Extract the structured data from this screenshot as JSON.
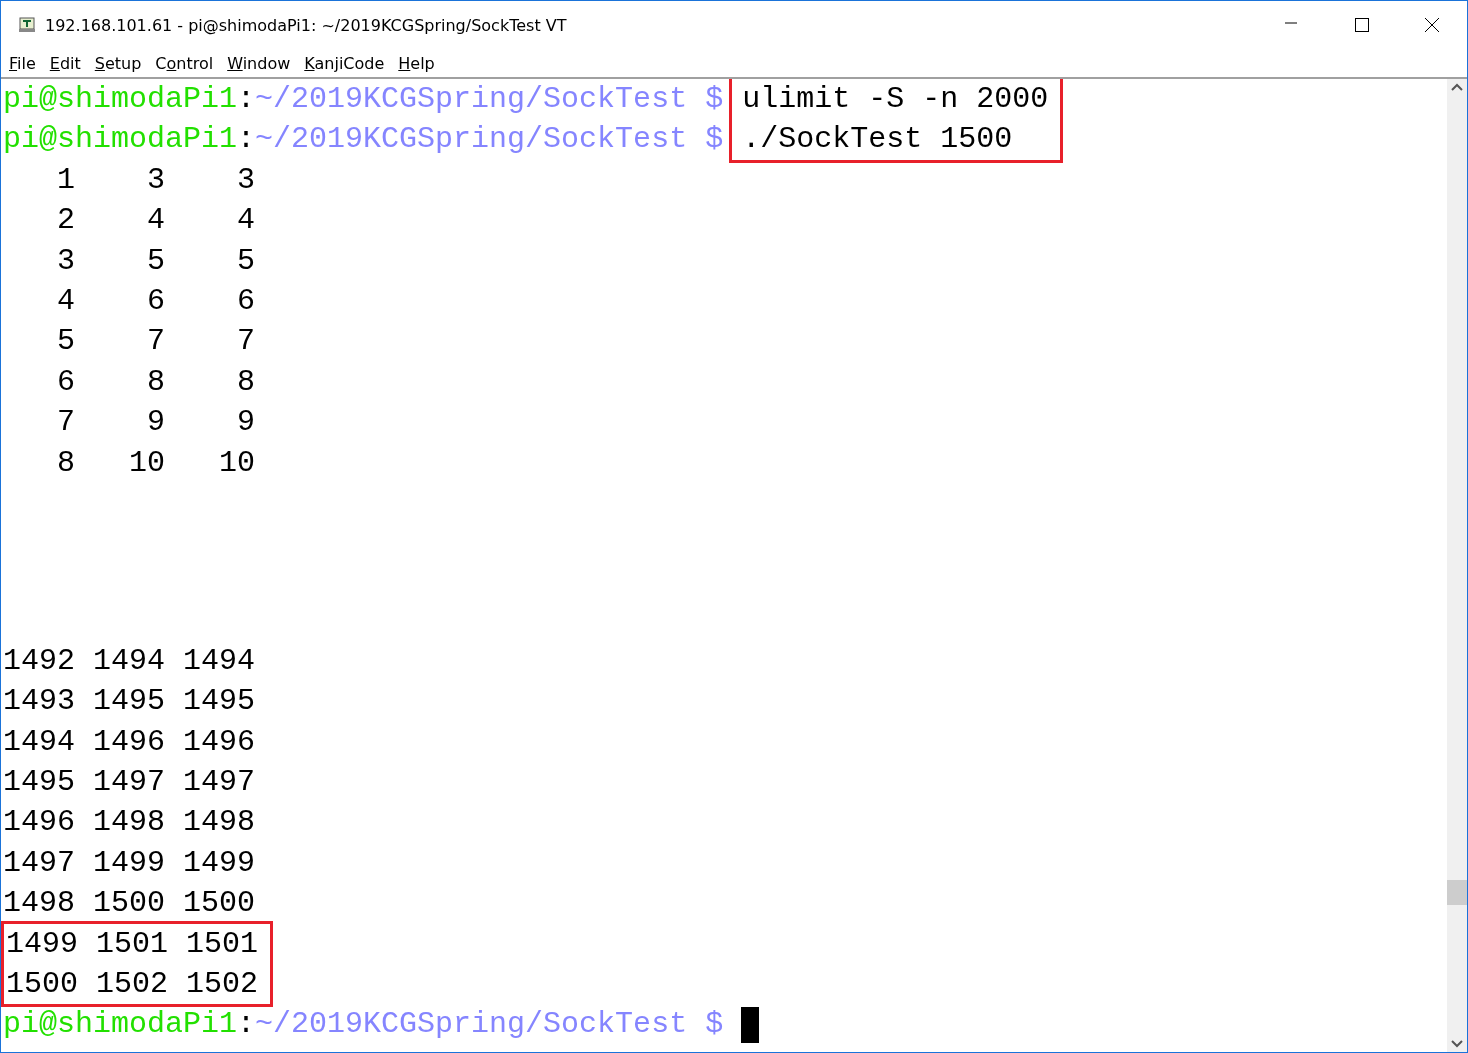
{
  "window": {
    "title": "192.168.101.61 - pi@shimodaPi1: ~/2019KCGSpring/SockTest VT"
  },
  "menu": [
    {
      "access_key": "F",
      "label_rest": "ile"
    },
    {
      "access_key": "E",
      "label_rest": "dit"
    },
    {
      "access_key": "S",
      "label_rest": "etup"
    },
    {
      "label_start": "C",
      "access_key": "o",
      "label_rest": "ntrol"
    },
    {
      "access_key": "W",
      "label_rest": "indow"
    },
    {
      "access_key": "K",
      "label_rest": "anjiCode"
    },
    {
      "access_key": "H",
      "label_rest": "elp"
    }
  ],
  "terminal": {
    "blocks": [
      {
        "kind": "prompts",
        "highlighted": true,
        "lines": [
          {
            "user": "pi@shimodaPi1",
            "sep": ":",
            "path": "~/2019KCGSpring/SockTest $",
            "command": "ulimit -S -n 2000"
          },
          {
            "user": "pi@shimodaPi1",
            "sep": ":",
            "path": "~/2019KCGSpring/SockTest $",
            "command": "./SockTest 1500"
          }
        ]
      },
      {
        "kind": "output",
        "highlighted": false,
        "rows": [
          "   1    3    3",
          "   2    4    4",
          "   3    5    5",
          "   4    6    6",
          "   5    7    7",
          "   6    8    8",
          "   7    9    9",
          "   8   10   10"
        ]
      },
      {
        "kind": "gap"
      },
      {
        "kind": "output",
        "highlighted": false,
        "rows": [
          "1492 1494 1494",
          "1493 1495 1495",
          "1494 1496 1496",
          "1495 1497 1497",
          "1496 1498 1498",
          "1497 1499 1499",
          "1498 1500 1500"
        ]
      },
      {
        "kind": "output",
        "highlighted": true,
        "rows": [
          "1499 1501 1501",
          "1500 1502 1502"
        ]
      },
      {
        "kind": "prompt",
        "cursor": true,
        "user": "pi@shimodaPi1",
        "sep": ":",
        "path": "~/2019KCGSpring/SockTest $"
      }
    ]
  }
}
